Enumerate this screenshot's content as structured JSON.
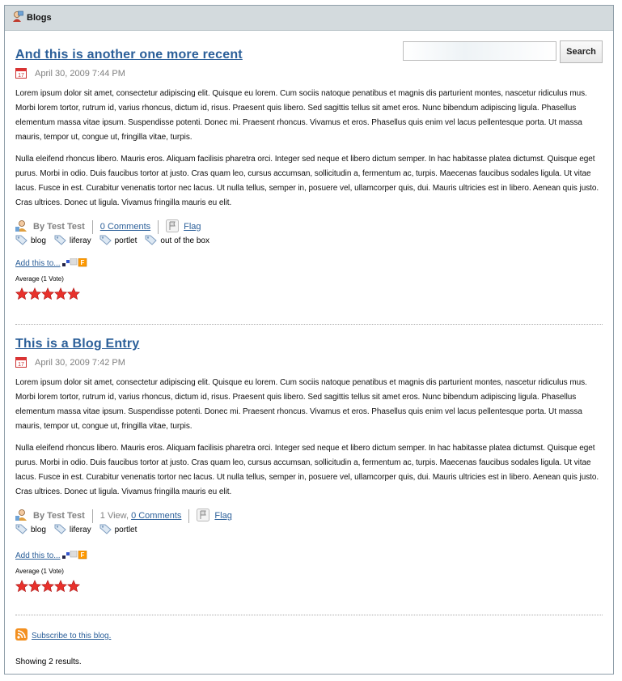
{
  "portlet": {
    "title": "Blogs"
  },
  "search": {
    "button_label": "Search",
    "value": ""
  },
  "entries": [
    {
      "title": "And this is another one more recent",
      "date": "April 30, 2009 7:44 PM",
      "p1": "Lorem ipsum dolor sit amet, consectetur adipiscing elit. Quisque eu lorem. Cum sociis natoque penatibus et magnis dis parturient montes, nascetur ridiculus mus. Morbi lorem tortor, rutrum id, varius rhoncus, dictum id, risus. Praesent quis libero. Sed sagittis tellus sit amet eros. Nunc bibendum adipiscing ligula. Phasellus elementum massa vitae ipsum. Suspendisse potenti. Donec mi. Praesent rhoncus. Vivamus et eros. Phasellus quis enim vel lacus pellentesque porta. Ut massa mauris, tempor ut, congue ut, fringilla vitae, turpis.",
      "p2": "Nulla eleifend rhoncus libero. Mauris eros. Aliquam facilisis pharetra orci. Integer sed neque et libero dictum semper. In hac habitasse platea dictumst. Quisque eget purus. Morbi in odio. Duis faucibus tortor at justo. Cras quam leo, cursus accumsan, sollicitudin a, fermentum ac, turpis. Maecenas faucibus sodales ligula. Ut vitae lacus. Fusce in est. Curabitur venenatis tortor nec lacus. Ut nulla tellus, semper in, posuere vel, ullamcorper quis, dui. Mauris ultricies est in libero. Aenean quis justo. Cras ultrices. Donec ut ligula. Vivamus fringilla mauris eu elit.",
      "author": "By Test Test",
      "views": "",
      "comments": "0 Comments",
      "flag": "Flag",
      "tags": [
        "blog",
        "liferay",
        "portlet",
        "out of the box"
      ],
      "add_this": "Add this to...",
      "average": "Average (1 Vote)",
      "rating": 5
    },
    {
      "title": "This is a Blog Entry",
      "date": "April 30, 2009 7:42 PM",
      "p1": "Lorem ipsum dolor sit amet, consectetur adipiscing elit. Quisque eu lorem. Cum sociis natoque penatibus et magnis dis parturient montes, nascetur ridiculus mus. Morbi lorem tortor, rutrum id, varius rhoncus, dictum id, risus. Praesent quis libero. Sed sagittis tellus sit amet eros. Nunc bibendum adipiscing ligula. Phasellus elementum massa vitae ipsum. Suspendisse potenti. Donec mi. Praesent rhoncus. Vivamus et eros. Phasellus quis enim vel lacus pellentesque porta. Ut massa mauris, tempor ut, congue ut, fringilla vitae, turpis.",
      "p2": "Nulla eleifend rhoncus libero. Mauris eros. Aliquam facilisis pharetra orci. Integer sed neque et libero dictum semper. In hac habitasse platea dictumst. Quisque eget purus. Morbi in odio. Duis faucibus tortor at justo. Cras quam leo, cursus accumsan, sollicitudin a, fermentum ac, turpis. Maecenas faucibus sodales ligula. Ut vitae lacus. Fusce in est. Curabitur venenatis tortor nec lacus. Ut nulla tellus, semper in, posuere vel, ullamcorper quis, dui. Mauris ultricies est in libero. Aenean quis justo. Cras ultrices. Donec ut ligula. Vivamus fringilla mauris eu elit.",
      "author": "By Test Test",
      "views": "1 View,",
      "comments": "0 Comments",
      "flag": "Flag",
      "tags": [
        "blog",
        "liferay",
        "portlet"
      ],
      "add_this": "Add this to...",
      "average": "Average (1 Vote)",
      "rating": 5
    }
  ],
  "footer": {
    "subscribe": "Subscribe to this blog.",
    "results": "Showing 2 results."
  },
  "colors": {
    "link": "#2b5f99",
    "star": "#e8312b",
    "titlebar": "#d3dadd"
  },
  "icons": [
    "blog-user-icon",
    "calendar-icon",
    "author-icon",
    "flag-icon",
    "tag-icon",
    "addthis-icon",
    "star-icon",
    "rss-icon"
  ]
}
